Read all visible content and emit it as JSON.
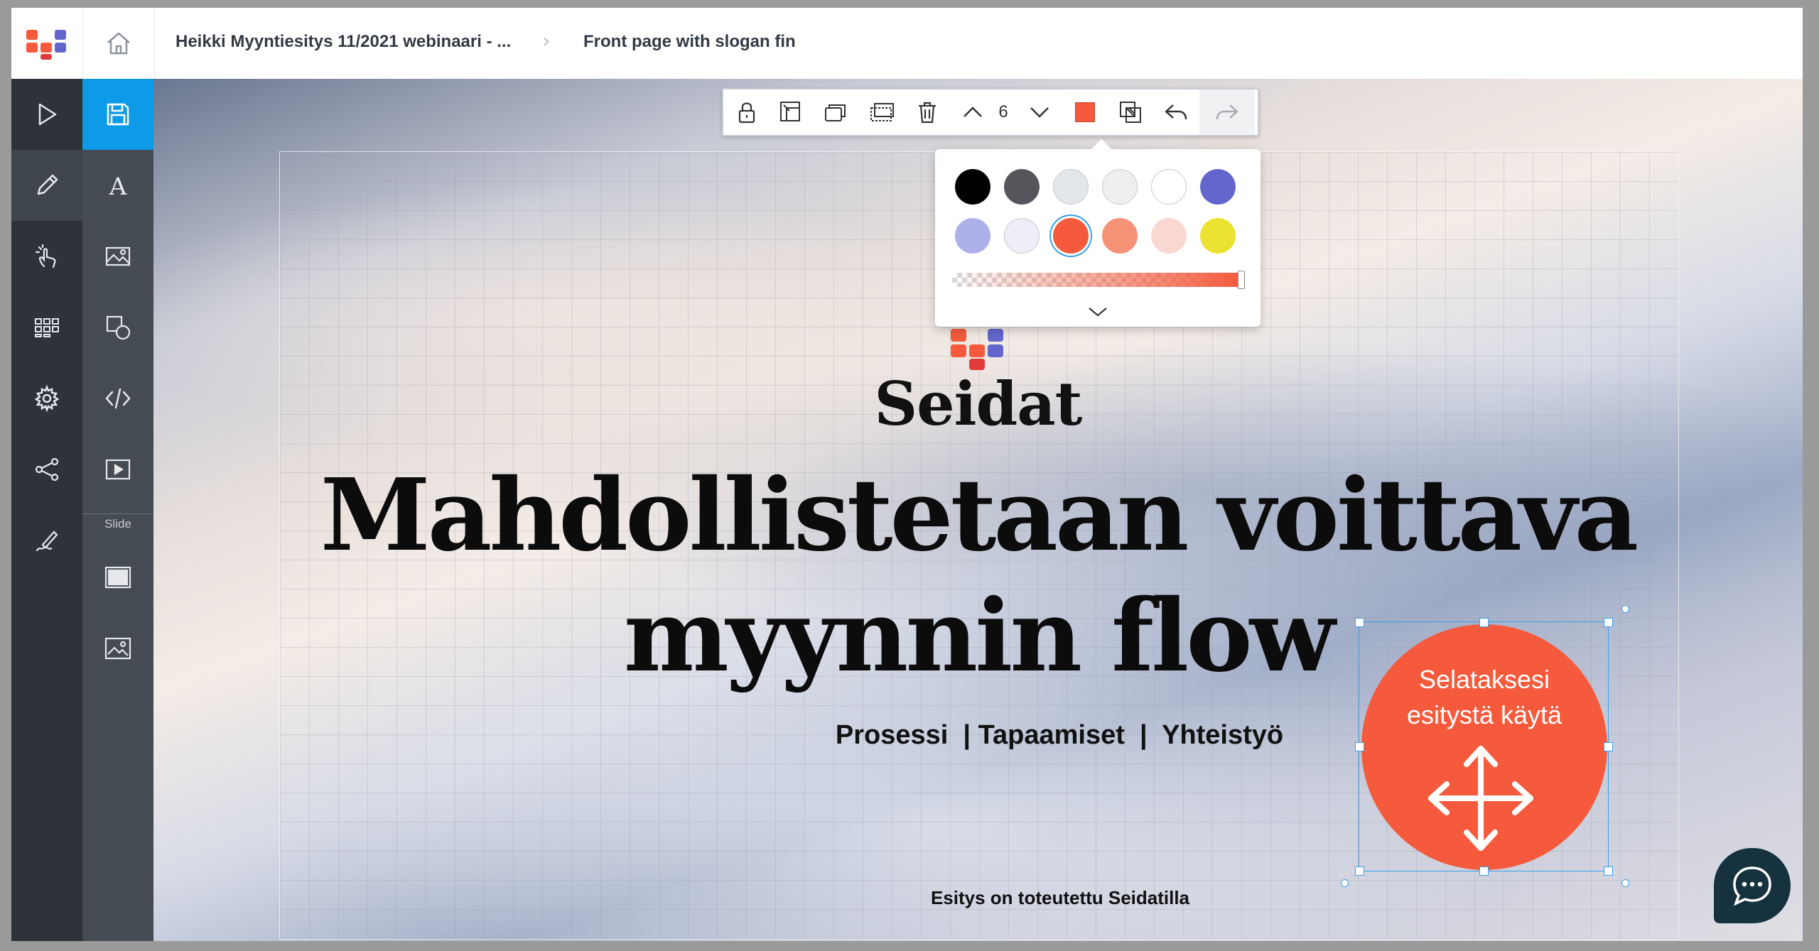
{
  "header": {
    "breadcrumb": [
      "Heikki Myyntiesitys 11/2021 webinaari - ...",
      "Front page with slogan fin"
    ],
    "separator": "›"
  },
  "rail": {
    "slide_label": "Slide"
  },
  "toolbar": {
    "layer_value": "6",
    "current_color": "#f55a3c"
  },
  "palette": {
    "colors": [
      "#000000",
      "#54565c",
      "#e3e6ea",
      "#eeeff1",
      "#ffffff",
      "#6466cc",
      "#aeb0ea",
      "#eeeef8",
      "#f55a3c",
      "#f69276",
      "#fad8d2",
      "#ece232"
    ],
    "selected": "#f55a3c"
  },
  "slide": {
    "brand": "Seidat",
    "headline_line1": "Mahdollistetaan voittava",
    "headline_line2": "myynnin flow",
    "subline": "Prosessi  | Tapaamiset  |  Yhteistyö",
    "circle_line1": "Selataksesi",
    "circle_line2": "esitystä käytä",
    "footer": "Esitys on toteutettu Seidatilla"
  },
  "icons": {
    "logo": "seidat-logo",
    "home": "home-icon",
    "chat": "chat-icon"
  }
}
